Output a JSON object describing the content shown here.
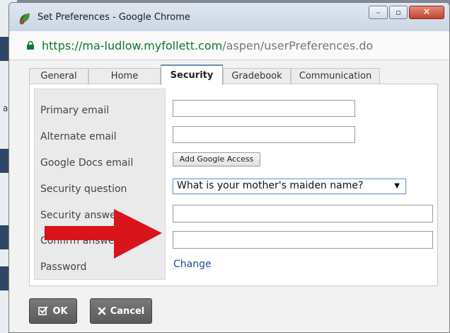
{
  "window": {
    "title": "Set Preferences - Google Chrome",
    "controls": {
      "minimize": "–",
      "maximize": "▫",
      "close": "✕"
    }
  },
  "address": {
    "scheme": "https://",
    "host": "ma-ludlow.myfollett.com",
    "path": "/aspen/userPreferences.do"
  },
  "background": {
    "partial_text": "ar"
  },
  "tabs": [
    {
      "label": "General"
    },
    {
      "label": "Home"
    },
    {
      "label": "Security",
      "active": true
    },
    {
      "label": "Gradebook"
    },
    {
      "label": "Communication"
    }
  ],
  "form": {
    "primary_email": {
      "label": "Primary email",
      "value": ""
    },
    "alternate_email": {
      "label": "Alternate email",
      "value": ""
    },
    "google_docs_email": {
      "label": "Google Docs email",
      "button": "Add Google Access"
    },
    "security_question": {
      "label": "Security question",
      "selected": "What is your mother's maiden name?"
    },
    "security_answer": {
      "label": "Security answer",
      "value": ""
    },
    "confirm_answer": {
      "label": "Confirm answer",
      "value": ""
    },
    "password": {
      "label": "Password",
      "link": "Change"
    }
  },
  "buttons": {
    "ok": "OK",
    "cancel": "Cancel"
  },
  "icons": {
    "app": "chrome-app-leaf-icon",
    "lock": "lock-icon",
    "ok": "checkbox-check-icon",
    "cancel": "x-icon",
    "arrow": "red-arrow-annotation"
  },
  "colors": {
    "annotation": "#d9141a",
    "url_host": "#0a7a2a",
    "link": "#1b4e9b"
  }
}
